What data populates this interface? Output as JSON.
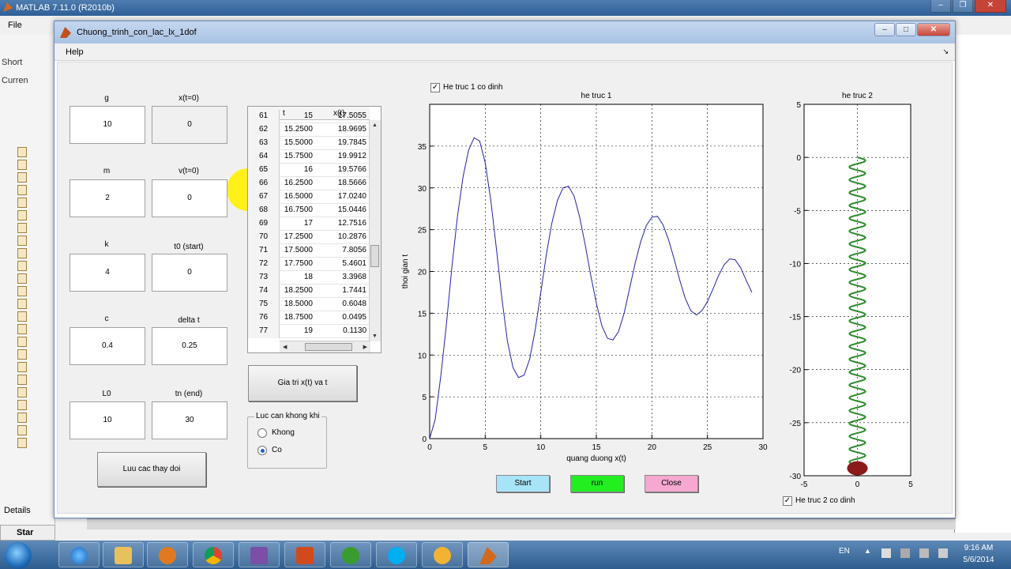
{
  "desktop": {
    "matlab_title": "MATLAB  7.11.0 (R2010b)",
    "file_menu": "File",
    "panel_labels": [
      "Short",
      "Curren"
    ],
    "details_label": "Details",
    "start_label": "Star"
  },
  "window": {
    "title": "Chuong_trinh_con_lac_lx_1dof",
    "menu_help": "Help"
  },
  "params": [
    {
      "label": "g",
      "value": "10"
    },
    {
      "label": "x(t=0)",
      "value": "0"
    },
    {
      "label": "m",
      "value": "2"
    },
    {
      "label": "v(t=0)",
      "value": "0"
    },
    {
      "label": "k",
      "value": "4"
    },
    {
      "label": "t0 (start)",
      "value": "0"
    },
    {
      "label": "c",
      "value": "0.4"
    },
    {
      "label": "delta t",
      "value": "0.25"
    },
    {
      "label": "L0",
      "value": "10"
    },
    {
      "label": "tn (end)",
      "value": "30"
    }
  ],
  "save_button": "Luu cac thay doi",
  "table": {
    "columns": [
      "t",
      "x(t)"
    ],
    "rows": [
      [
        "61",
        "15",
        "17.5055"
      ],
      [
        "62",
        "15.2500",
        "18.9695"
      ],
      [
        "63",
        "15.5000",
        "19.7845"
      ],
      [
        "64",
        "15.7500",
        "19.9912"
      ],
      [
        "65",
        "16",
        "19.5766"
      ],
      [
        "66",
        "16.2500",
        "18.5666"
      ],
      [
        "67",
        "16.5000",
        "17.0240"
      ],
      [
        "68",
        "16.7500",
        "15.0446"
      ],
      [
        "69",
        "17",
        "12.7516"
      ],
      [
        "70",
        "17.2500",
        "10.2876"
      ],
      [
        "71",
        "17.5000",
        "7.8056"
      ],
      [
        "72",
        "17.7500",
        "5.4601"
      ],
      [
        "73",
        "18",
        "3.3968"
      ],
      [
        "74",
        "18.2500",
        "1.7441"
      ],
      [
        "75",
        "18.5000",
        "0.6048"
      ],
      [
        "76",
        "18.7500",
        "0.0495"
      ],
      [
        "77",
        "19",
        "0.1130"
      ]
    ]
  },
  "xt_button": "Gia tri x(t) va t",
  "air_group": {
    "title": "Luc can khong khi",
    "options": [
      "Khong",
      "Co"
    ],
    "selected": "Co"
  },
  "buttons": {
    "start": "Start",
    "run": "run",
    "close": "Close",
    "start_color": "#a8e4f8",
    "run_color": "#22ee22",
    "close_color": "#f6a8d0"
  },
  "fix1_label": "He truc 1 co dinh",
  "fix2_label": "He truc 2 co dinh",
  "chart_data": [
    {
      "type": "line",
      "title": "he truc 1",
      "xlabel": "quang duong x(t)",
      "ylabel": "thoi gian t",
      "xlim": [
        0,
        30
      ],
      "ylim": [
        0,
        40
      ],
      "xticks": [
        0,
        5,
        10,
        15,
        20,
        25,
        30
      ],
      "yticks": [
        0,
        5,
        10,
        15,
        20,
        25,
        30,
        35
      ],
      "grid": true,
      "series": [
        {
          "color": "#2222aa",
          "x": [
            0,
            0.5,
            1,
            1.5,
            2,
            2.5,
            3,
            3.5,
            4,
            4.5,
            5,
            5.5,
            6,
            6.5,
            7,
            7.5,
            8,
            8.5,
            9,
            9.5,
            10,
            10.5,
            11,
            11.5,
            12,
            12.5,
            13,
            13.5,
            14,
            14.5,
            15,
            15.5,
            16,
            16.5,
            17,
            17.5,
            18,
            18.5,
            19,
            19.5,
            20,
            20.5,
            21,
            21.5,
            22,
            22.5,
            23,
            23.5,
            24,
            24.5,
            25,
            25.5,
            26,
            26.5,
            27,
            27.5,
            28,
            28.5,
            29
          ],
          "y": [
            0,
            2.3,
            7.5,
            13.6,
            20.5,
            26.6,
            31.3,
            34.5,
            36.0,
            35.6,
            33.0,
            28.5,
            22.8,
            16.8,
            11.6,
            8.5,
            7.3,
            7.6,
            9.5,
            13.0,
            17.5,
            22.0,
            25.8,
            28.5,
            30.0,
            30.2,
            29.0,
            26.5,
            23.2,
            19.5,
            16.2,
            13.5,
            12.0,
            11.8,
            12.8,
            15.0,
            18.0,
            21.0,
            23.6,
            25.5,
            26.5,
            26.6,
            25.6,
            23.8,
            21.5,
            19.0,
            16.8,
            15.3,
            14.8,
            15.3,
            16.4,
            17.9,
            19.5,
            20.8,
            21.5,
            21.4,
            20.4,
            18.9,
            17.5
          ]
        }
      ]
    },
    {
      "type": "diagram",
      "title": "he truc 2",
      "xlim": [
        -5,
        5
      ],
      "ylim": [
        -30,
        5
      ],
      "xticks": [
        -5,
        0,
        5
      ],
      "yticks": [
        5,
        0,
        -5,
        -10,
        -15,
        -20,
        -25,
        -30
      ],
      "grid": true,
      "spring_top": 0,
      "spring_bottom": -29,
      "coils": 24,
      "spring_color": "#2e8b2e",
      "mass_color": "#8b1a1a"
    }
  ],
  "taskbar": {
    "language": "EN",
    "time": "9:16 AM",
    "date": "5/6/2014"
  }
}
